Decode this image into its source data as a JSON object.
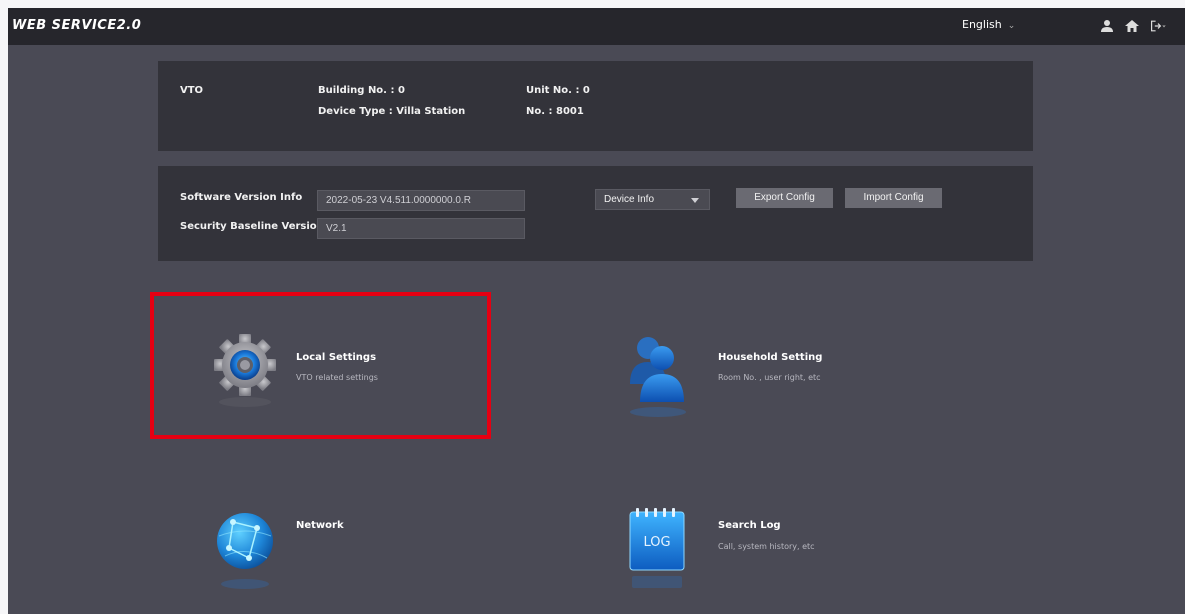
{
  "header": {
    "logo": "WEB SERVICE2.0",
    "language": "English",
    "icons": [
      "user-icon",
      "home-icon",
      "logout-icon"
    ]
  },
  "device": {
    "type_label": "VTO",
    "building": "Building No. : 0",
    "device_type": "Device Type : Villa Station",
    "unit": "Unit No. : 0",
    "number": "No. : 8001"
  },
  "version": {
    "software_label": "Software Version Info",
    "software_value": "2022-05-23 V4.511.0000000.0.R",
    "baseline_label": "Security Baseline Version",
    "baseline_value": "V2.1",
    "dropdown_selected": "Device Info",
    "export_label": "Export Config",
    "import_label": "Import Config"
  },
  "tiles": {
    "local": {
      "title": "Local Settings",
      "subtitle": "VTO related settings"
    },
    "household": {
      "title": "Household Setting",
      "subtitle": "Room No. , user right, etc"
    },
    "network": {
      "title": "Network",
      "subtitle": ""
    },
    "log": {
      "title": "Search Log",
      "subtitle": "Call, system history, etc",
      "icon_text": "LOG"
    }
  },
  "colors": {
    "highlight": "#e60012",
    "topbar": "#26262c",
    "background": "#4a4a55",
    "card": "#33333a"
  }
}
